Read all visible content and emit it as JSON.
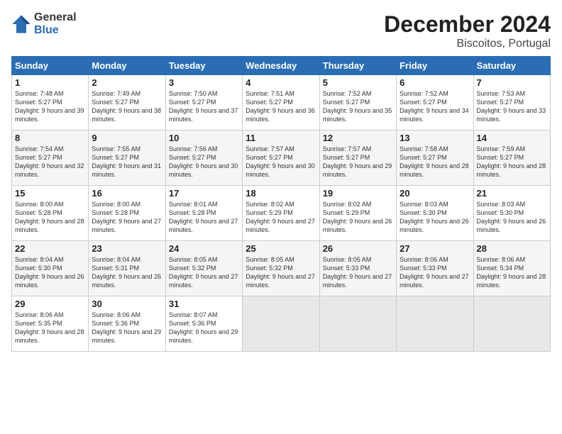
{
  "logo": {
    "general": "General",
    "blue": "Blue"
  },
  "header": {
    "month": "December 2024",
    "location": "Biscoitos, Portugal"
  },
  "weekdays": [
    "Sunday",
    "Monday",
    "Tuesday",
    "Wednesday",
    "Thursday",
    "Friday",
    "Saturday"
  ],
  "weeks": [
    [
      {
        "day": "1",
        "sunrise": "Sunrise: 7:48 AM",
        "sunset": "Sunset: 5:27 PM",
        "daylight": "Daylight: 9 hours and 39 minutes."
      },
      {
        "day": "2",
        "sunrise": "Sunrise: 7:49 AM",
        "sunset": "Sunset: 5:27 PM",
        "daylight": "Daylight: 9 hours and 38 minutes."
      },
      {
        "day": "3",
        "sunrise": "Sunrise: 7:50 AM",
        "sunset": "Sunset: 5:27 PM",
        "daylight": "Daylight: 9 hours and 37 minutes."
      },
      {
        "day": "4",
        "sunrise": "Sunrise: 7:51 AM",
        "sunset": "Sunset: 5:27 PM",
        "daylight": "Daylight: 9 hours and 36 minutes."
      },
      {
        "day": "5",
        "sunrise": "Sunrise: 7:52 AM",
        "sunset": "Sunset: 5:27 PM",
        "daylight": "Daylight: 9 hours and 35 minutes."
      },
      {
        "day": "6",
        "sunrise": "Sunrise: 7:52 AM",
        "sunset": "Sunset: 5:27 PM",
        "daylight": "Daylight: 9 hours and 34 minutes."
      },
      {
        "day": "7",
        "sunrise": "Sunrise: 7:53 AM",
        "sunset": "Sunset: 5:27 PM",
        "daylight": "Daylight: 9 hours and 33 minutes."
      }
    ],
    [
      {
        "day": "8",
        "sunrise": "Sunrise: 7:54 AM",
        "sunset": "Sunset: 5:27 PM",
        "daylight": "Daylight: 9 hours and 32 minutes."
      },
      {
        "day": "9",
        "sunrise": "Sunrise: 7:55 AM",
        "sunset": "Sunset: 5:27 PM",
        "daylight": "Daylight: 9 hours and 31 minutes."
      },
      {
        "day": "10",
        "sunrise": "Sunrise: 7:56 AM",
        "sunset": "Sunset: 5:27 PM",
        "daylight": "Daylight: 9 hours and 30 minutes."
      },
      {
        "day": "11",
        "sunrise": "Sunrise: 7:57 AM",
        "sunset": "Sunset: 5:27 PM",
        "daylight": "Daylight: 9 hours and 30 minutes."
      },
      {
        "day": "12",
        "sunrise": "Sunrise: 7:57 AM",
        "sunset": "Sunset: 5:27 PM",
        "daylight": "Daylight: 9 hours and 29 minutes."
      },
      {
        "day": "13",
        "sunrise": "Sunrise: 7:58 AM",
        "sunset": "Sunset: 5:27 PM",
        "daylight": "Daylight: 9 hours and 28 minutes."
      },
      {
        "day": "14",
        "sunrise": "Sunrise: 7:59 AM",
        "sunset": "Sunset: 5:27 PM",
        "daylight": "Daylight: 9 hours and 28 minutes."
      }
    ],
    [
      {
        "day": "15",
        "sunrise": "Sunrise: 8:00 AM",
        "sunset": "Sunset: 5:28 PM",
        "daylight": "Daylight: 9 hours and 28 minutes."
      },
      {
        "day": "16",
        "sunrise": "Sunrise: 8:00 AM",
        "sunset": "Sunset: 5:28 PM",
        "daylight": "Daylight: 9 hours and 27 minutes."
      },
      {
        "day": "17",
        "sunrise": "Sunrise: 8:01 AM",
        "sunset": "Sunset: 5:28 PM",
        "daylight": "Daylight: 9 hours and 27 minutes."
      },
      {
        "day": "18",
        "sunrise": "Sunrise: 8:02 AM",
        "sunset": "Sunset: 5:29 PM",
        "daylight": "Daylight: 9 hours and 27 minutes."
      },
      {
        "day": "19",
        "sunrise": "Sunrise: 8:02 AM",
        "sunset": "Sunset: 5:29 PM",
        "daylight": "Daylight: 9 hours and 26 minutes."
      },
      {
        "day": "20",
        "sunrise": "Sunrise: 8:03 AM",
        "sunset": "Sunset: 5:30 PM",
        "daylight": "Daylight: 9 hours and 26 minutes."
      },
      {
        "day": "21",
        "sunrise": "Sunrise: 8:03 AM",
        "sunset": "Sunset: 5:30 PM",
        "daylight": "Daylight: 9 hours and 26 minutes."
      }
    ],
    [
      {
        "day": "22",
        "sunrise": "Sunrise: 8:04 AM",
        "sunset": "Sunset: 5:30 PM",
        "daylight": "Daylight: 9 hours and 26 minutes."
      },
      {
        "day": "23",
        "sunrise": "Sunrise: 8:04 AM",
        "sunset": "Sunset: 5:31 PM",
        "daylight": "Daylight: 9 hours and 26 minutes."
      },
      {
        "day": "24",
        "sunrise": "Sunrise: 8:05 AM",
        "sunset": "Sunset: 5:32 PM",
        "daylight": "Daylight: 9 hours and 27 minutes."
      },
      {
        "day": "25",
        "sunrise": "Sunrise: 8:05 AM",
        "sunset": "Sunset: 5:32 PM",
        "daylight": "Daylight: 9 hours and 27 minutes."
      },
      {
        "day": "26",
        "sunrise": "Sunrise: 8:05 AM",
        "sunset": "Sunset: 5:33 PM",
        "daylight": "Daylight: 9 hours and 27 minutes."
      },
      {
        "day": "27",
        "sunrise": "Sunrise: 8:06 AM",
        "sunset": "Sunset: 5:33 PM",
        "daylight": "Daylight: 9 hours and 27 minutes."
      },
      {
        "day": "28",
        "sunrise": "Sunrise: 8:06 AM",
        "sunset": "Sunset: 5:34 PM",
        "daylight": "Daylight: 9 hours and 28 minutes."
      }
    ],
    [
      {
        "day": "29",
        "sunrise": "Sunrise: 8:06 AM",
        "sunset": "Sunset: 5:35 PM",
        "daylight": "Daylight: 9 hours and 28 minutes."
      },
      {
        "day": "30",
        "sunrise": "Sunrise: 8:06 AM",
        "sunset": "Sunset: 5:36 PM",
        "daylight": "Daylight: 9 hours and 29 minutes."
      },
      {
        "day": "31",
        "sunrise": "Sunrise: 8:07 AM",
        "sunset": "Sunset: 5:36 PM",
        "daylight": "Daylight: 9 hours and 29 minutes."
      },
      null,
      null,
      null,
      null
    ]
  ]
}
